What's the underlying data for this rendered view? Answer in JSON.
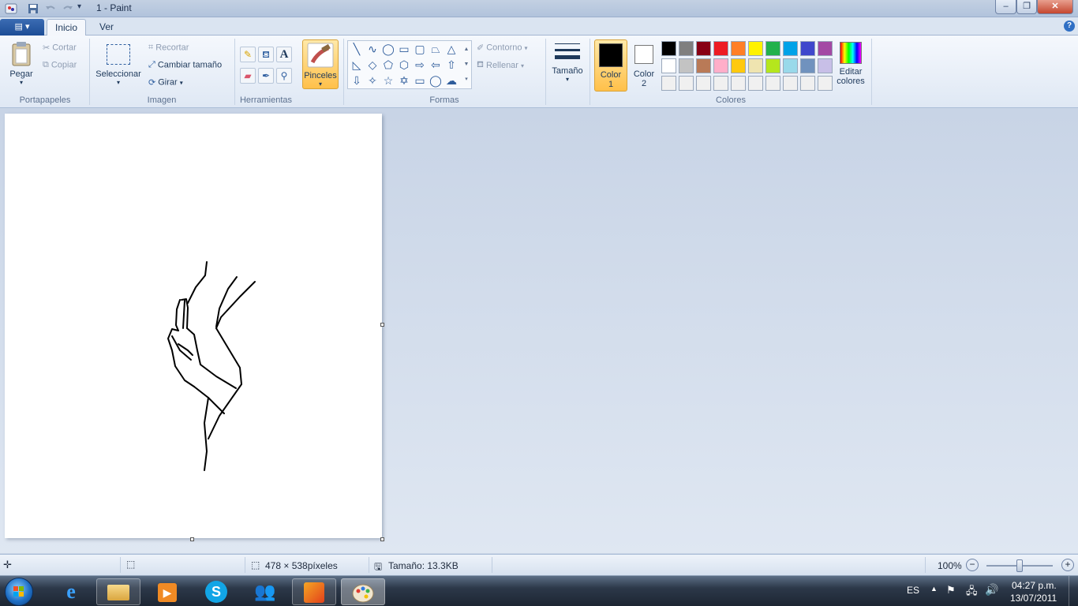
{
  "window": {
    "title": "1 - Paint"
  },
  "tabs": {
    "app_menu": "▤ ▾",
    "inicio": "Inicio",
    "ver": "Ver",
    "help": "?"
  },
  "portapapeles": {
    "label": "Portapapeles",
    "pegar": "Pegar",
    "cortar": "Cortar",
    "copiar": "Copiar"
  },
  "imagen": {
    "label": "Imagen",
    "seleccionar": "Seleccionar",
    "recortar": "Recortar",
    "cambiar_tamano": "Cambiar tamaño",
    "girar": "Girar"
  },
  "herramientas": {
    "label": "Herramientas",
    "text_tool": "A"
  },
  "pinceles": {
    "label": "Pinceles"
  },
  "formas": {
    "label": "Formas",
    "contorno": "Contorno",
    "rellenar": "Rellenar"
  },
  "tamano": {
    "label": "Tamaño"
  },
  "color1": {
    "label": "Color 1",
    "value": "#000000"
  },
  "color2": {
    "label": "Color 2",
    "value": "#ffffff"
  },
  "colores": {
    "label": "Colores",
    "editar": "Editar colores",
    "row1": [
      "#000000",
      "#7f7f7f",
      "#880015",
      "#ed1c24",
      "#ff7f27",
      "#fff200",
      "#22b14c",
      "#00a2e8",
      "#3f48cc",
      "#a349a4"
    ],
    "row2": [
      "#ffffff",
      "#c3c3c3",
      "#b97a57",
      "#ffaec9",
      "#ffc90e",
      "#efe4b0",
      "#b5e61d",
      "#99d9ea",
      "#7092be",
      "#c8bfe7"
    ],
    "row3": [
      "#f0f0f0",
      "#f0f0f0",
      "#f0f0f0",
      "#f0f0f0",
      "#f0f0f0",
      "#f0f0f0",
      "#f0f0f0",
      "#f0f0f0",
      "#f0f0f0",
      "#f0f0f0"
    ]
  },
  "status": {
    "dimensions": "478 × 538píxeles",
    "size": "Tamaño: 13.3KB",
    "zoom": "100%"
  },
  "tray": {
    "lang": "ES",
    "time": "04:27 p.m.",
    "date": "13/07/2011"
  }
}
